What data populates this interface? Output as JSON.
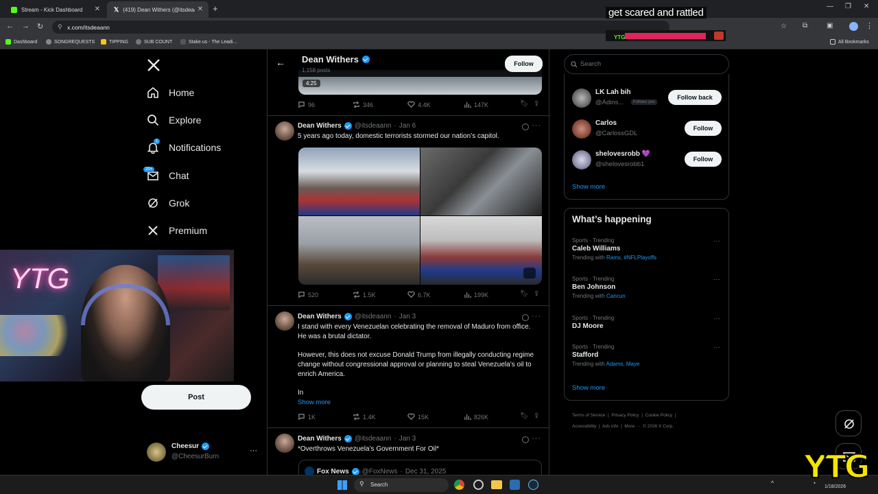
{
  "browser": {
    "tabs": [
      {
        "title": "Stream - Kick Dashboard",
        "active": false
      },
      {
        "title": "(419) Dean Withers (@itsdeaan",
        "active": true
      }
    ],
    "url": "x.com/itsdeaann",
    "bookmarks": [
      "Dashboard",
      "SONGREQUESTS",
      "TIPPING",
      "SUB COUNT",
      "Stake.us - The Leadi..."
    ],
    "all_bookmarks": "All Bookmarks"
  },
  "overlay": {
    "caption": "get scared and rattled",
    "badge_text": "YTG",
    "corner_logo": "YTG"
  },
  "nav": {
    "items": [
      {
        "label": "Home",
        "icon": "home-icon"
      },
      {
        "label": "Explore",
        "icon": "search-icon"
      },
      {
        "label": "Notifications",
        "icon": "bell-icon",
        "badge": "1"
      },
      {
        "label": "Chat",
        "icon": "mail-icon",
        "badge": "20+"
      },
      {
        "label": "Grok",
        "icon": "grok-icon"
      },
      {
        "label": "Premium",
        "icon": "x-logo-icon"
      }
    ],
    "post_label": "Post",
    "account": {
      "name": "Cheesur",
      "handle": "@CheesurBurn"
    }
  },
  "profile_header": {
    "name": "Dean Withers",
    "posts": "1,158 posts",
    "follow_label": "Follow"
  },
  "tweets": [
    {
      "video_duration": "4:25",
      "stats": {
        "replies": "96",
        "reposts": "346",
        "likes": "4.4K",
        "views": "147K"
      }
    },
    {
      "name": "Dean Withers",
      "handle": "@itsdeaann",
      "date": "Jan 6",
      "text": "5 years ago today, domestic terrorists stormed our nation’s capitol.",
      "stats": {
        "replies": "520",
        "reposts": "1.5K",
        "likes": "6.7K",
        "views": "199K"
      }
    },
    {
      "name": "Dean Withers",
      "handle": "@itsdeaann",
      "date": "Jan 3",
      "text_p1": "I stand with every Venezuelan celebrating the removal of Maduro from office. He was a brutal dictator.",
      "text_p2": "However, this does not excuse Donald Trump from illegally conducting regime change without congressional approval or planning to steal Venezuela’s oil to enrich America.",
      "text_p3": "In",
      "show_more": "Show more",
      "stats": {
        "replies": "1K",
        "reposts": "1.4K",
        "likes": "15K",
        "views": "826K"
      }
    },
    {
      "name": "Dean Withers",
      "handle": "@itsdeaann",
      "date": "Jan 3",
      "text": "*Overthrows Venezuela’s Government For Oil*",
      "quote": {
        "name": "Fox News",
        "handle": "@FoxNews",
        "date": "Dec 31, 2025"
      }
    }
  ],
  "search_placeholder": "Search",
  "who_to_follow": {
    "accounts": [
      {
        "name": "LK Lah bih",
        "handle": "@Adins...",
        "tag": "Follows you",
        "button": "Follow back"
      },
      {
        "name": "Carlos",
        "handle": "@CarlossGDL",
        "button": "Follow"
      },
      {
        "name": "shelovesrobb 💜",
        "handle": "@shelovesrobb1",
        "button": "Follow"
      }
    ],
    "show_more": "Show more"
  },
  "whats_happening": {
    "title": "What’s happening",
    "trends": [
      {
        "meta": "Sports · Trending",
        "name": "Caleb Williams",
        "with_prefix": "Trending with",
        "with": "Rams, #NFLPlayoffs"
      },
      {
        "meta": "Sports · Trending",
        "name": "Ben Johnson",
        "with_prefix": "Trending with",
        "with": "Cancun"
      },
      {
        "meta": "Sports · Trending",
        "name": "DJ Moore",
        "with_prefix": "",
        "with": ""
      },
      {
        "meta": "Sports · Trending",
        "name": "Stafford",
        "with_prefix": "Trending with",
        "with": "Adams, Maye"
      }
    ],
    "show_more": "Show more"
  },
  "footer": {
    "links": [
      "Terms of Service",
      "Privacy Policy",
      "Cookie Policy",
      "Accessibility",
      "Ads info",
      "More ···",
      "© 2026 X Corp."
    ]
  },
  "taskbar": {
    "search": "Search",
    "date": "1/18/2026"
  },
  "colors": {
    "accent": "#1d9bf0",
    "bg": "#000000",
    "border": "#2f3336",
    "muted": "#71767b",
    "overlay_red": "#e0245e"
  }
}
